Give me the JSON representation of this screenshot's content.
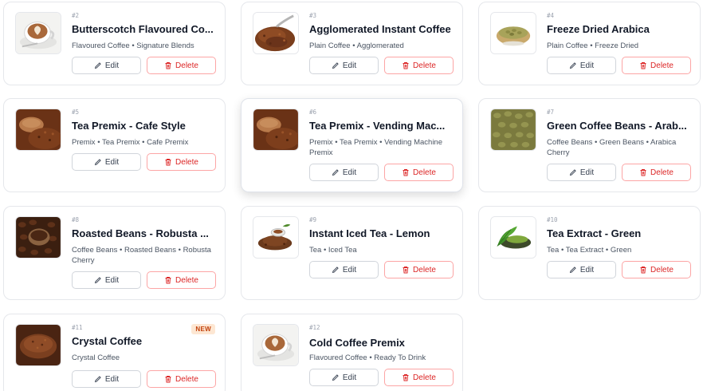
{
  "actions": {
    "edit_label": "Edit",
    "delete_label": "Delete"
  },
  "products": [
    {
      "number": "#2",
      "title": "Butterscotch Flavoured Co...",
      "categories": "Flavoured Coffee • Signature Blends",
      "image": "cappuccino-cup"
    },
    {
      "number": "#3",
      "title": "Agglomerated Instant Coffee",
      "categories": "Plain Coffee • Agglomerated",
      "image": "coffee-granules-spoon"
    },
    {
      "number": "#4",
      "title": "Freeze Dried Arabica",
      "categories": "Plain Coffee • Freeze Dried",
      "image": "green-beans-bowl"
    },
    {
      "number": "#5",
      "title": "Tea Premix - Cafe Style",
      "categories": "Premix • Tea Premix • Cafe Premix",
      "image": "premix-powder-scoop"
    },
    {
      "number": "#6",
      "title": "Tea Premix - Vending Mac...",
      "categories": "Premix • Tea Premix • Vending Machine Premix",
      "image": "premix-powder-scoop"
    },
    {
      "number": "#7",
      "title": "Green Coffee Beans - Arab...",
      "categories": "Coffee Beans • Green Beans • Arabica Cherry",
      "image": "green-coffee-beans"
    },
    {
      "number": "#8",
      "title": "Roasted Beans - Robusta ...",
      "categories": "Coffee Beans • Roasted Beans • Robusta Cherry",
      "image": "roasted-beans-scoop"
    },
    {
      "number": "#9",
      "title": "Instant Iced Tea - Lemon",
      "categories": "Tea • Iced Tea",
      "image": "tea-granules-pile"
    },
    {
      "number": "#10",
      "title": "Tea Extract - Green",
      "categories": "Tea • Tea Extract • Green",
      "image": "green-tea-leaves"
    },
    {
      "number": "#11",
      "title": "Crystal Coffee",
      "categories": "Crystal Coffee",
      "image": "coffee-powder-bowl",
      "badge": "NEW"
    },
    {
      "number": "#12",
      "title": "Cold Coffee Premix",
      "categories": "Flavoured Coffee • Ready To Drink",
      "image": "cappuccino-cup"
    }
  ],
  "colors": {
    "delete": "#dc2626",
    "delete_border": "#fca5a5",
    "badge_bg": "#fde7d3",
    "badge_text": "#c2410c"
  }
}
